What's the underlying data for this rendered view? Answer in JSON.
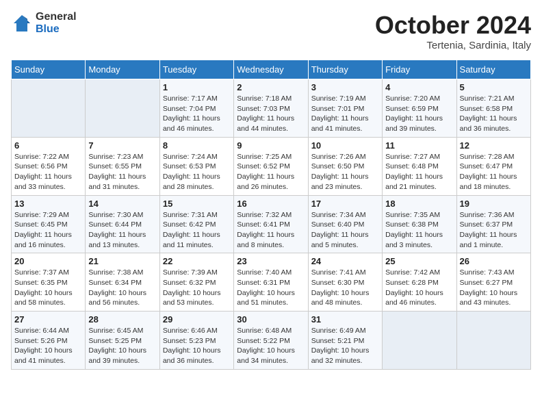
{
  "logo": {
    "general": "General",
    "blue": "Blue"
  },
  "header": {
    "month": "October 2024",
    "location": "Tertenia, Sardinia, Italy"
  },
  "days_of_week": [
    "Sunday",
    "Monday",
    "Tuesday",
    "Wednesday",
    "Thursday",
    "Friday",
    "Saturday"
  ],
  "weeks": [
    [
      {
        "day": "",
        "info": ""
      },
      {
        "day": "",
        "info": ""
      },
      {
        "day": "1",
        "info": "Sunrise: 7:17 AM\nSunset: 7:04 PM\nDaylight: 11 hours and 46 minutes."
      },
      {
        "day": "2",
        "info": "Sunrise: 7:18 AM\nSunset: 7:03 PM\nDaylight: 11 hours and 44 minutes."
      },
      {
        "day": "3",
        "info": "Sunrise: 7:19 AM\nSunset: 7:01 PM\nDaylight: 11 hours and 41 minutes."
      },
      {
        "day": "4",
        "info": "Sunrise: 7:20 AM\nSunset: 6:59 PM\nDaylight: 11 hours and 39 minutes."
      },
      {
        "day": "5",
        "info": "Sunrise: 7:21 AM\nSunset: 6:58 PM\nDaylight: 11 hours and 36 minutes."
      }
    ],
    [
      {
        "day": "6",
        "info": "Sunrise: 7:22 AM\nSunset: 6:56 PM\nDaylight: 11 hours and 33 minutes."
      },
      {
        "day": "7",
        "info": "Sunrise: 7:23 AM\nSunset: 6:55 PM\nDaylight: 11 hours and 31 minutes."
      },
      {
        "day": "8",
        "info": "Sunrise: 7:24 AM\nSunset: 6:53 PM\nDaylight: 11 hours and 28 minutes."
      },
      {
        "day": "9",
        "info": "Sunrise: 7:25 AM\nSunset: 6:52 PM\nDaylight: 11 hours and 26 minutes."
      },
      {
        "day": "10",
        "info": "Sunrise: 7:26 AM\nSunset: 6:50 PM\nDaylight: 11 hours and 23 minutes."
      },
      {
        "day": "11",
        "info": "Sunrise: 7:27 AM\nSunset: 6:48 PM\nDaylight: 11 hours and 21 minutes."
      },
      {
        "day": "12",
        "info": "Sunrise: 7:28 AM\nSunset: 6:47 PM\nDaylight: 11 hours and 18 minutes."
      }
    ],
    [
      {
        "day": "13",
        "info": "Sunrise: 7:29 AM\nSunset: 6:45 PM\nDaylight: 11 hours and 16 minutes."
      },
      {
        "day": "14",
        "info": "Sunrise: 7:30 AM\nSunset: 6:44 PM\nDaylight: 11 hours and 13 minutes."
      },
      {
        "day": "15",
        "info": "Sunrise: 7:31 AM\nSunset: 6:42 PM\nDaylight: 11 hours and 11 minutes."
      },
      {
        "day": "16",
        "info": "Sunrise: 7:32 AM\nSunset: 6:41 PM\nDaylight: 11 hours and 8 minutes."
      },
      {
        "day": "17",
        "info": "Sunrise: 7:34 AM\nSunset: 6:40 PM\nDaylight: 11 hours and 5 minutes."
      },
      {
        "day": "18",
        "info": "Sunrise: 7:35 AM\nSunset: 6:38 PM\nDaylight: 11 hours and 3 minutes."
      },
      {
        "day": "19",
        "info": "Sunrise: 7:36 AM\nSunset: 6:37 PM\nDaylight: 11 hours and 1 minute."
      }
    ],
    [
      {
        "day": "20",
        "info": "Sunrise: 7:37 AM\nSunset: 6:35 PM\nDaylight: 10 hours and 58 minutes."
      },
      {
        "day": "21",
        "info": "Sunrise: 7:38 AM\nSunset: 6:34 PM\nDaylight: 10 hours and 56 minutes."
      },
      {
        "day": "22",
        "info": "Sunrise: 7:39 AM\nSunset: 6:32 PM\nDaylight: 10 hours and 53 minutes."
      },
      {
        "day": "23",
        "info": "Sunrise: 7:40 AM\nSunset: 6:31 PM\nDaylight: 10 hours and 51 minutes."
      },
      {
        "day": "24",
        "info": "Sunrise: 7:41 AM\nSunset: 6:30 PM\nDaylight: 10 hours and 48 minutes."
      },
      {
        "day": "25",
        "info": "Sunrise: 7:42 AM\nSunset: 6:28 PM\nDaylight: 10 hours and 46 minutes."
      },
      {
        "day": "26",
        "info": "Sunrise: 7:43 AM\nSunset: 6:27 PM\nDaylight: 10 hours and 43 minutes."
      }
    ],
    [
      {
        "day": "27",
        "info": "Sunrise: 6:44 AM\nSunset: 5:26 PM\nDaylight: 10 hours and 41 minutes."
      },
      {
        "day": "28",
        "info": "Sunrise: 6:45 AM\nSunset: 5:25 PM\nDaylight: 10 hours and 39 minutes."
      },
      {
        "day": "29",
        "info": "Sunrise: 6:46 AM\nSunset: 5:23 PM\nDaylight: 10 hours and 36 minutes."
      },
      {
        "day": "30",
        "info": "Sunrise: 6:48 AM\nSunset: 5:22 PM\nDaylight: 10 hours and 34 minutes."
      },
      {
        "day": "31",
        "info": "Sunrise: 6:49 AM\nSunset: 5:21 PM\nDaylight: 10 hours and 32 minutes."
      },
      {
        "day": "",
        "info": ""
      },
      {
        "day": "",
        "info": ""
      }
    ]
  ]
}
